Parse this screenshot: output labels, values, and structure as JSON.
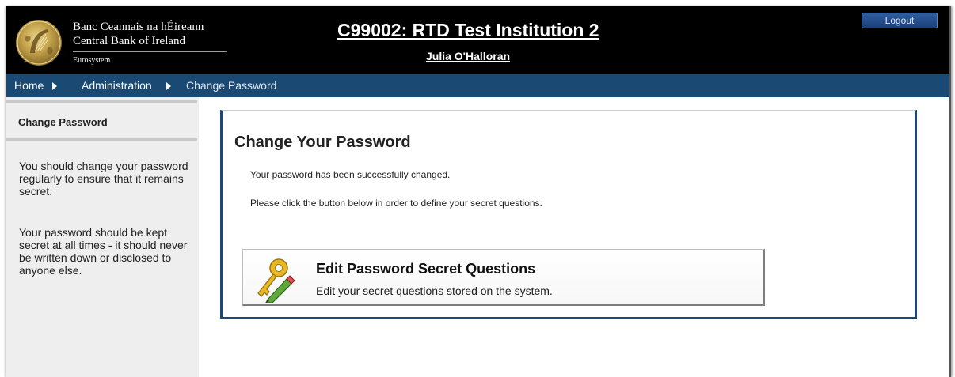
{
  "header": {
    "bank_name_irish": "Banc Ceannais na hÉireann",
    "bank_name_english": "Central Bank of Ireland",
    "eurosystem": "Eurosystem",
    "institution_title": "C99002: RTD Test Institution 2",
    "user_name": "Julia O'Halloran",
    "logout_label": "Logout"
  },
  "breadcrumb": {
    "items": [
      "Home",
      "Administration",
      "Change Password"
    ]
  },
  "sidebar": {
    "title": "Change Password",
    "paragraph1": "You should change your password regularly to ensure that it remains secret.",
    "paragraph2": "Your password should be kept secret at all times - it should never be written down or disclosed to anyone else."
  },
  "main": {
    "title": "Change Your Password",
    "success_message": "Your password has been successfully changed.",
    "instruction": "Please click the button below in order to define your secret questions.",
    "action_button": {
      "title": "Edit Password Secret Questions",
      "description": "Edit your secret questions stored on the system.",
      "icon": "key-pencil-icon"
    }
  },
  "colors": {
    "header_bg": "#000000",
    "nav_bg": "#1a4a74",
    "sidebar_bg": "#eeeeee",
    "panel_border": "#1a4a74"
  }
}
